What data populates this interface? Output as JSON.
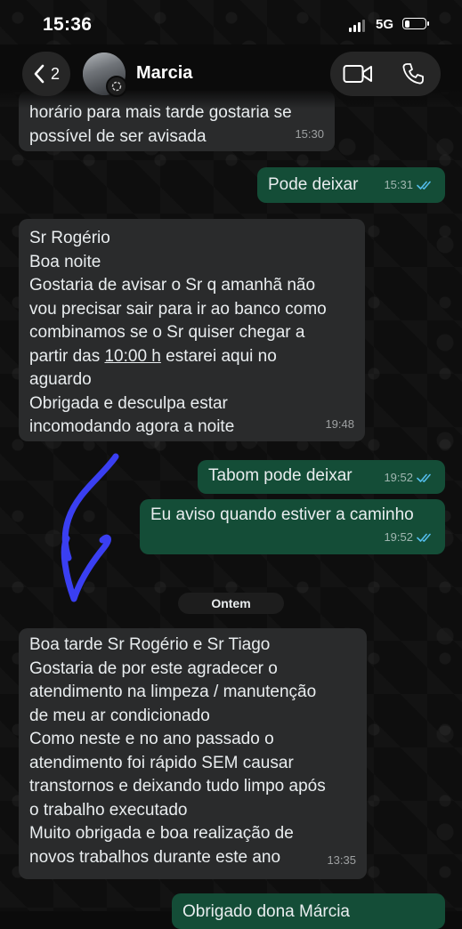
{
  "status_bar": {
    "time": "15:36",
    "network": "5G",
    "battery_level": 0.25
  },
  "header": {
    "back_count": "2",
    "contact_name": "Marcia",
    "icons": {
      "back": "chevron-left-icon",
      "video": "video-call-icon",
      "phone": "phone-icon",
      "status": "status-ring-icon"
    }
  },
  "messages": [
    {
      "dir": "in",
      "lines": [
        "horário para mais tarde gostaria se",
        "possível de ser avisada"
      ],
      "time": "15:30"
    },
    {
      "dir": "out",
      "lines": [
        "Pode deixar"
      ],
      "time": "15:31"
    },
    {
      "dir": "in",
      "lines": [
        "Sr Rogério",
        "Boa noite",
        "Gostaria de avisar o Sr q amanhã  não",
        "vou precisar sair para ir ao banco como",
        "combinamos se o Sr quiser chegar a",
        "partir das 10:00 h estarei aqui no",
        "aguardo",
        "Obrigada e desculpa estar",
        "incomodando agora a noite"
      ],
      "time": "19:48",
      "underlined": "10:00 h"
    },
    {
      "dir": "out",
      "lines": [
        "Tabom pode deixar"
      ],
      "time": "19:52"
    },
    {
      "dir": "out",
      "lines": [
        "Eu aviso quando estiver a caminho"
      ],
      "time": "19:52"
    },
    {
      "dir": "in",
      "lines": [
        "Boa tarde Sr Rogério e Sr Tiago",
        "Gostaria de por este agradecer o",
        "atendimento na limpeza / manutenção",
        "de meu ar condicionado",
        "Como neste e no ano passado o",
        "atendimento foi rápido SEM causar",
        "transtornos e deixando tudo limpo após",
        "o trabalho executado",
        "Muito obrigada e boa realização de",
        "novos trabalhos durante este ano"
      ],
      "time": "13:35"
    },
    {
      "dir": "out",
      "lines": [
        "Obrigado dona Márcia"
      ],
      "time": ""
    }
  ],
  "date_separator": "Ontem",
  "colors": {
    "incoming": "#2a2b2c",
    "outgoing": "#144d37",
    "ticks": "#53bdeb",
    "annotation": "#3a3ff2"
  }
}
